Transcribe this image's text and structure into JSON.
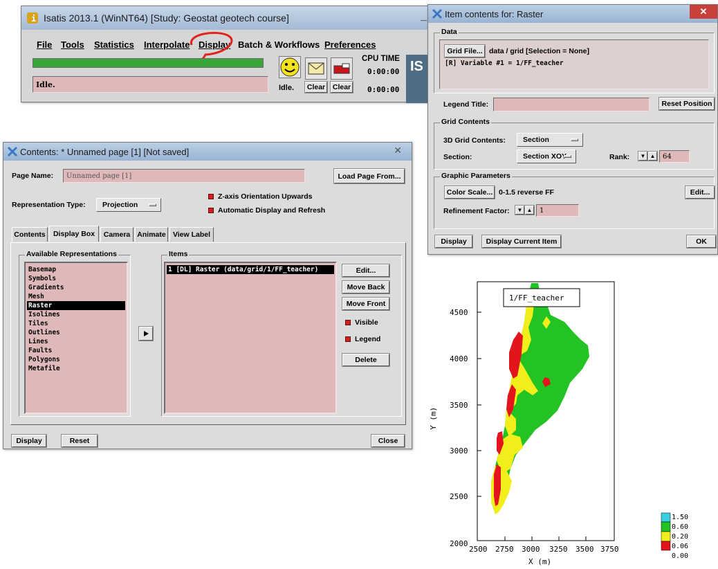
{
  "main_window": {
    "title": "Isatis 2013.1 (WinNT64) [Study: Geostat geotech course]",
    "menu": [
      "File",
      "Tools",
      "Statistics",
      "Interpolate",
      "Display",
      "Batch & Workflows",
      "Preferences"
    ],
    "status_text": "Idle.",
    "status_label": "Idle.",
    "clear1": "Clear",
    "clear2": "Clear",
    "cpu_time_label": "CPU TIME",
    "cpu_time_1": "0:00:00",
    "cpu_time_2": "0:00:00",
    "progress_color": "#3aa63a",
    "annotation_color": "#e0241b"
  },
  "contents_window": {
    "title": "Contents: * Unnamed page [1] [Not saved]",
    "page_name_label": "Page Name:",
    "page_name_value": "Unnamed page [1]",
    "load_page_button": "Load Page From...",
    "representation_type_label": "Representation Type:",
    "representation_type_value": "Projection",
    "z_axis_check": "Z-axis Orientation Upwards",
    "auto_display_check": "Automatic Display and Refresh",
    "tabs": [
      "Contents",
      "Display Box",
      "Camera",
      "Animate",
      "View Label"
    ],
    "available_title": "Available Representations",
    "available": [
      "Basemap",
      "Symbols",
      "Gradients",
      "Mesh",
      "Raster",
      "Isolines",
      "Tiles",
      "Outlines",
      "Lines",
      "Faults",
      "Polygons",
      "Metafile"
    ],
    "available_selected": "Raster",
    "items_title": "Items",
    "items": [
      "1 [DL] Raster (data/grid/1/FF_teacher)"
    ],
    "edit_button": "Edit...",
    "move_back_button": "Move Back",
    "move_front_button": "Move Front",
    "visible_check": "Visible",
    "legend_check": "Legend",
    "delete_button": "Delete",
    "display_button": "Display",
    "reset_button": "Reset",
    "close_button": "Close"
  },
  "item_window": {
    "title": "Item contents for: Raster",
    "data_group": "Data",
    "grid_file_button": "Grid File...",
    "grid_file_text": "data / grid [Selection = None]",
    "variable_text": "[R] Variable #1 = 1/FF_teacher",
    "legend_title_label": "Legend Title:",
    "legend_title_value": "",
    "reset_position_button": "Reset Position",
    "grid_contents_group": "Grid Contents",
    "grid3d_label": "3D Grid Contents:",
    "grid3d_value": "Section",
    "section_label": "Section:",
    "section_value": "Section XOY",
    "rank_label": "Rank:",
    "rank_value": "64",
    "graphic_group": "Graphic Parameters",
    "color_scale_button": "Color Scale...",
    "color_scale_text": "0-1.5 reverse FF",
    "edit_button": "Edit...",
    "refinement_label": "Refinement Factor:",
    "refinement_value": "1",
    "display_button": "Display",
    "display_current_button": "Display Current Item",
    "ok_button": "OK"
  },
  "map": {
    "title": "1/FF_teacher",
    "x_label": "X (m)",
    "y_label": "Y (m)",
    "x_ticks": [
      "2500",
      "2750",
      "3000",
      "3250",
      "3500",
      "3750"
    ],
    "y_ticks": [
      "2000",
      "2500",
      "3000",
      "3500",
      "4000",
      "4500"
    ],
    "legend": [
      {
        "label": "1.50",
        "color": "#38d0e0"
      },
      {
        "label": "0.60",
        "color": "#22c322"
      },
      {
        "label": "0.20",
        "color": "#f2ee1c"
      },
      {
        "label": "0.06",
        "color": "#e4141c"
      },
      {
        "label": "0.00",
        "color": ""
      }
    ]
  }
}
